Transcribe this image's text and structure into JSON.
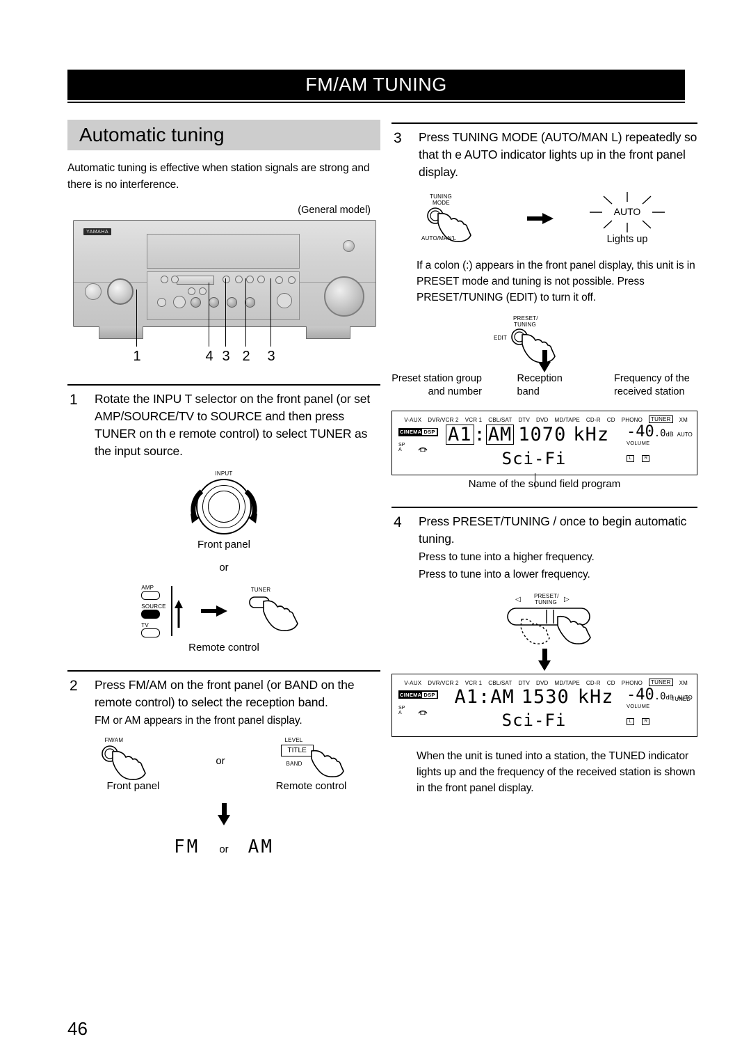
{
  "header": {
    "title": "FM/AM TUNING"
  },
  "section": {
    "title": "Automatic tuning"
  },
  "intro": "Automatic tuning is effective when station signals are strong and there is no interference.",
  "receiver": {
    "model_note": "(General model)",
    "brand": "YAMAHA",
    "callouts": [
      "1",
      "4",
      "3",
      "2",
      "3"
    ]
  },
  "steps": {
    "s1": {
      "num": "1",
      "text": "Rotate the INPU T selector on the front panel (or set AMP/SOURCE/TV to SOURCE and then press TUNER on th e remote control) to select TUNER as the input source.",
      "dial_label": "INPUT",
      "caption_front": "Front panel",
      "or": "or",
      "remote_amp": "AMP",
      "remote_source": "SOURCE",
      "remote_tv": "TV",
      "remote_tuner": "TUNER",
      "caption_remote": "Remote control"
    },
    "s2": {
      "num": "2",
      "text": "Press FM/AM on the front panel (or BAND on the remote control) to select the reception band.",
      "subtext": "FM or AM appears in the front panel display.",
      "btn_fmam": "FM/AM",
      "caption_front": "Front panel",
      "or": "or",
      "btn_level": "LEVEL",
      "btn_title": "TITLE",
      "btn_band": "BAND",
      "caption_remote": "Remote control",
      "result_fm": "FM",
      "result_or": "or",
      "result_am": "AM"
    },
    "s3": {
      "num": "3",
      "text": "Press TUNING MODE  (AUTO/MAN L) repeatedly so that th  e AUTO indicator lights up in the front panel display.",
      "btn_tuning": "TUNING",
      "btn_mode": "MODE",
      "btn_automanl": "AUTO/MAN'L",
      "auto_label": "AUTO",
      "lights_up": "Lights up",
      "note": "If a colon (:) appears in the front panel display, this unit is in PRESET mode and tuning is not possible. Press PRESET/TUNING (EDIT) to turn it off.",
      "btn_preset": "PRESET/",
      "btn_tuning2": "TUNING",
      "btn_edit": "EDIT",
      "callout_preset": "Preset station group and number",
      "callout_band": "Reception band",
      "callout_freq": "Frequency of the received station",
      "callout_program": "Name of the sound field program"
    },
    "s4": {
      "num": "4",
      "text": "Press PRESET/TUNING      /       once to begin automatic tuning.",
      "press_higher": "Press      to tune into a higher frequency.",
      "press_lower": "Press      to tune into a lower frequency.",
      "btn_preset": "PRESET/",
      "btn_tuning": "TUNING",
      "arrow_left": "◁",
      "arrow_right": "▷",
      "closing": "When the unit is tuned into a station, the TUNED indicator lights up and the frequency of the received station is shown in the front panel display."
    }
  },
  "lcd_sources": [
    "V-AUX",
    "DVR/VCR 2",
    "VCR 1",
    "CBL/SAT",
    "DTV",
    "DVD",
    "MD/TAPE",
    "CD-R",
    "CD",
    "PHONO",
    "TUNER",
    "XM"
  ],
  "lcd1": {
    "cinema": "CINEMA",
    "dsp": "DSP",
    "sp": "SP",
    "sp_ch": "A",
    "preset": "A1",
    "colon": ":",
    "band": "AM",
    "freq": "1070",
    "unit": "kHz",
    "program": "Sci-Fi",
    "volume_value": "-40",
    "volume_dec": ".0",
    "volume_db": "dB",
    "volume_label": "VOLUME",
    "auto": "AUTO",
    "box_l": "L",
    "box_r": "R"
  },
  "lcd2": {
    "cinema": "CINEMA",
    "dsp": "DSP",
    "sp": "SP",
    "sp_ch": "A",
    "preset": "A1",
    "colon": ":",
    "band": "AM",
    "freq": "1530",
    "unit": "kHz",
    "program": "Sci-Fi",
    "volume_value": "-40",
    "volume_dec": ".0",
    "volume_db": "dB",
    "volume_label": "VOLUME",
    "auto": "AUTO",
    "tuned": "TUNED",
    "box_l": "L",
    "box_r": "R"
  },
  "page_number": "46"
}
